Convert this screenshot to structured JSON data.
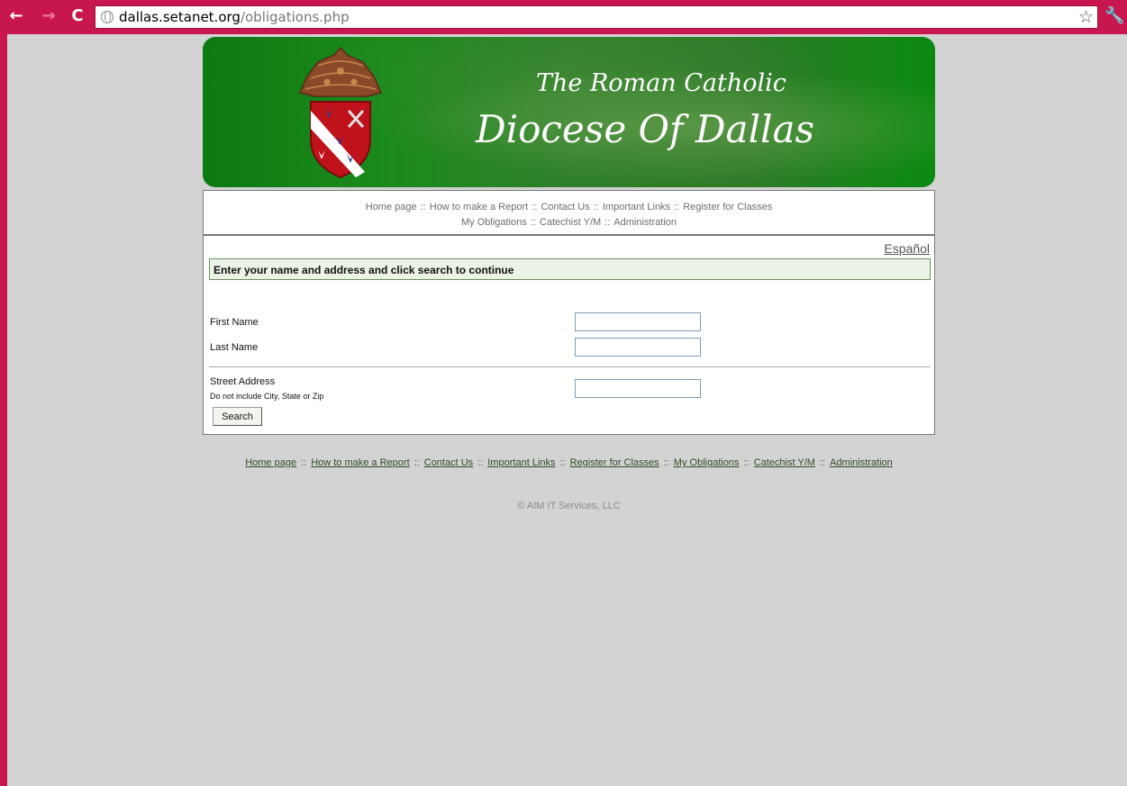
{
  "browser": {
    "url_host": "dallas.setanet.org",
    "url_path": "/obligations.php",
    "back_icon": "back-arrow-icon",
    "forward_icon": "forward-arrow-icon",
    "reload_icon": "reload-icon"
  },
  "banner": {
    "line1": "The Roman Catholic",
    "line2": "Diocese Of Dallas",
    "crest_icon": "diocese-crest"
  },
  "nav": {
    "row1": [
      "Home page",
      "How to make a Report",
      "Contact Us",
      "Important Links",
      "Register for Classes"
    ],
    "row2": [
      "My Obligations",
      "Catechist Y/M",
      "Administration"
    ],
    "separator": "::"
  },
  "form": {
    "language_link": "Español",
    "instructions": "Enter your name and address and click search to continue",
    "first_name_label": "First Name",
    "first_name_value": "",
    "last_name_label": "Last Name",
    "last_name_value": "",
    "street_label": "Street Address",
    "street_hint": "Do not include City, State or Zip",
    "street_value": "",
    "search_button": "Search"
  },
  "footer": {
    "links": [
      "Home page",
      "How to make a Report",
      "Contact Us",
      "Important Links",
      "Register for Classes",
      "My Obligations",
      "Catechist Y/M",
      "Administration"
    ],
    "separator": "::",
    "copyright": "© AIM IT Services, LLC"
  },
  "colors": {
    "chrome": "#c8174f",
    "page_background": "#d3d3d3",
    "banner_green": "#1b8a1c",
    "instruction_bg": "#eaf3e6",
    "footer_link": "#2f4b24"
  }
}
